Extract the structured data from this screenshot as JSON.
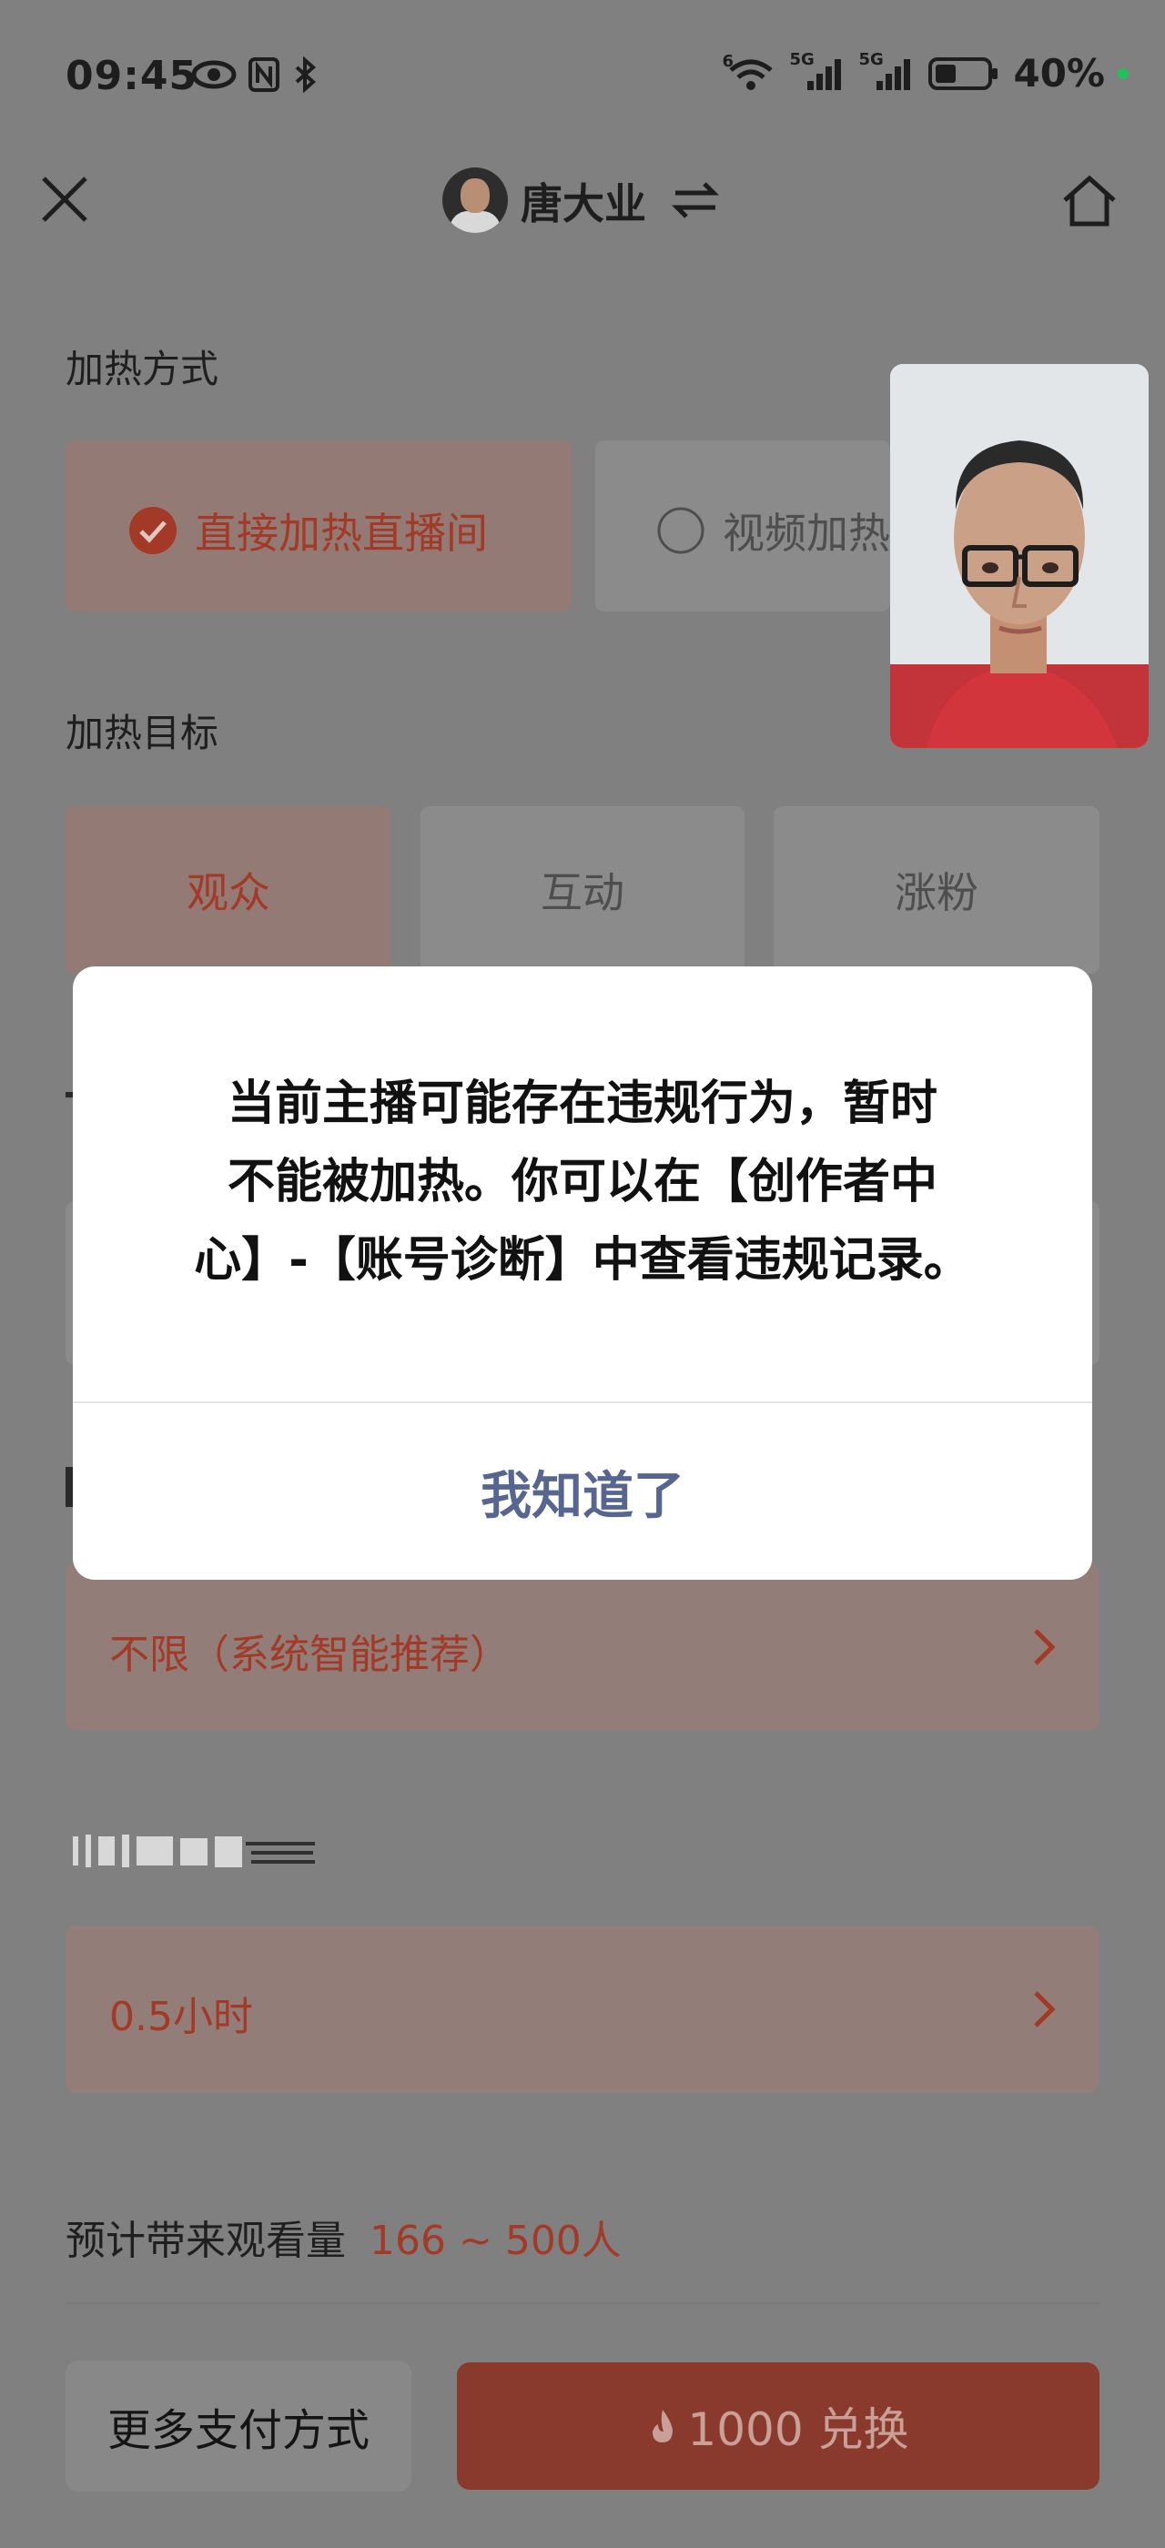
{
  "status_bar": {
    "time": "09:45",
    "network_label_1": "5G",
    "network_label_2": "5G",
    "wifi_label": "6",
    "battery_percent": "40%",
    "battery_level": 0.4
  },
  "header": {
    "username": "唐大业"
  },
  "heat_method": {
    "label": "加热方式",
    "options": [
      {
        "label": "直接加热直播间",
        "selected": true
      },
      {
        "label": "视频加热",
        "selected": false
      }
    ]
  },
  "heat_target": {
    "label": "加热目标",
    "options": [
      {
        "label": "观众",
        "selected": true
      },
      {
        "label": "互动",
        "selected": false
      },
      {
        "label": "涨粉",
        "selected": false
      }
    ]
  },
  "audience_row": {
    "value": "不限（系统智能推荐）"
  },
  "duration_row": {
    "value": "0.5小时"
  },
  "estimate": {
    "label": "预计带来观看量",
    "value": "166 ~ 500人"
  },
  "footer": {
    "pay_methods_label": "更多支付方式",
    "buy_label": "1000 兑换"
  },
  "dialog": {
    "message_line_1": "当前主播可能存在违规行为，暂时",
    "message_line_2": "不能被加热。你可以在【创作者中",
    "message_line_3": "心】-【账号诊断】中查看违规记录。",
    "confirm_label": "我知道了"
  },
  "colors": {
    "accent": "#a33a27",
    "dialog_button": "#566690",
    "overlay": "#808080"
  }
}
